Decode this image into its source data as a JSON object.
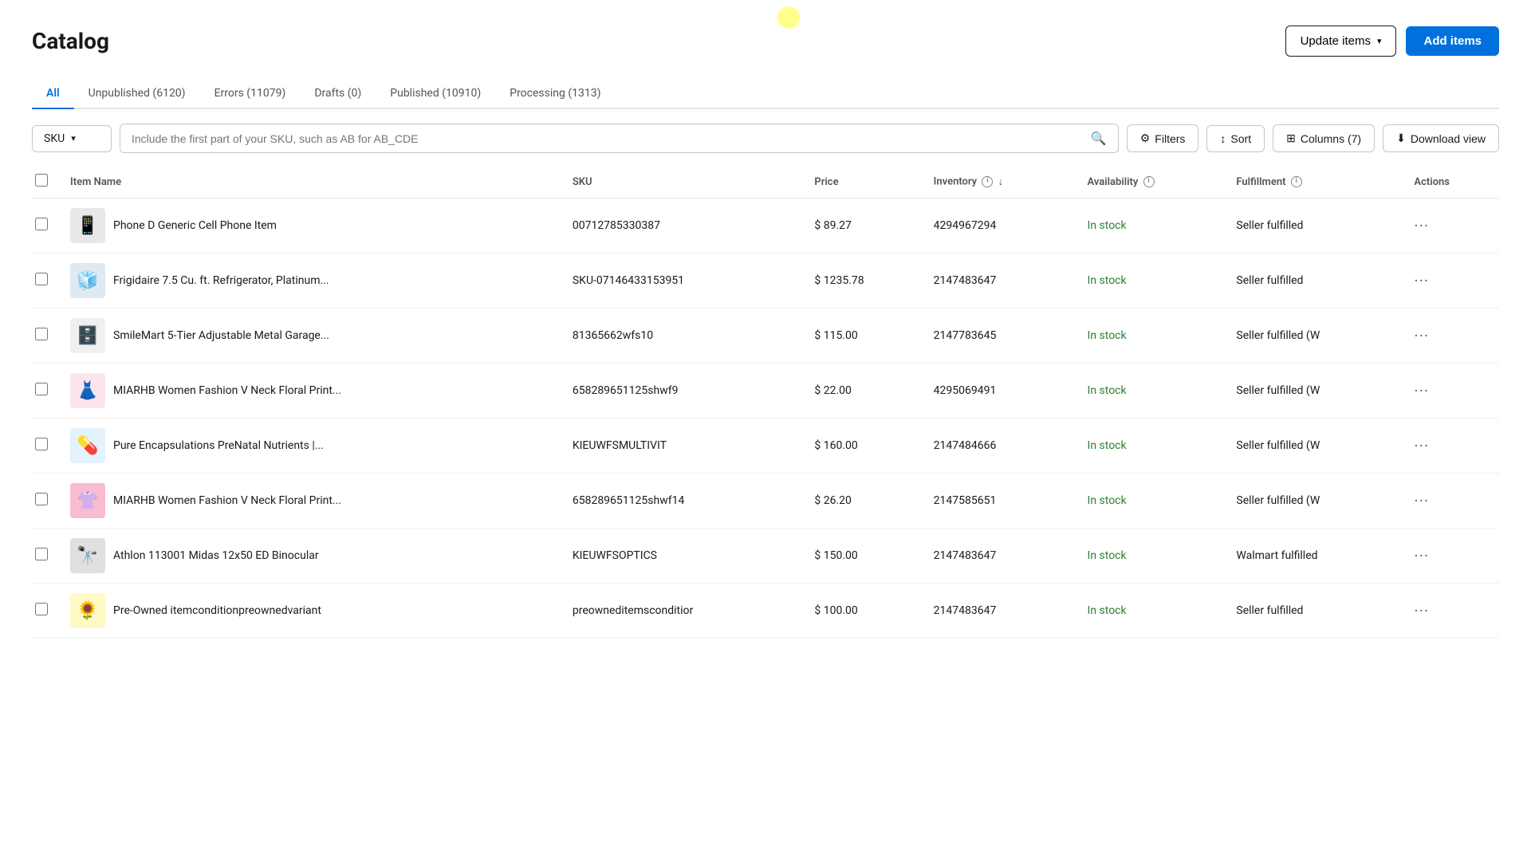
{
  "page": {
    "title": "Catalog"
  },
  "header": {
    "update_items_label": "Update items",
    "add_items_label": "Add items"
  },
  "tabs": [
    {
      "id": "all",
      "label": "All",
      "active": true
    },
    {
      "id": "unpublished",
      "label": "Unpublished (6120)",
      "active": false
    },
    {
      "id": "errors",
      "label": "Errors (11079)",
      "active": false
    },
    {
      "id": "drafts",
      "label": "Drafts (0)",
      "active": false
    },
    {
      "id": "published",
      "label": "Published (10910)",
      "active": false
    },
    {
      "id": "processing",
      "label": "Processing (1313)",
      "active": false
    }
  ],
  "toolbar": {
    "sku_label": "SKU",
    "search_placeholder": "Include the first part of your SKU, such as AB for AB_CDE",
    "filters_label": "Filters",
    "sort_label": "Sort",
    "columns_label": "Columns (7)",
    "download_label": "Download view"
  },
  "table": {
    "columns": [
      {
        "id": "name",
        "label": "Item Name"
      },
      {
        "id": "sku",
        "label": "SKU"
      },
      {
        "id": "price",
        "label": "Price"
      },
      {
        "id": "inventory",
        "label": "Inventory",
        "has_info": true,
        "has_sort": true
      },
      {
        "id": "availability",
        "label": "Availability",
        "has_info": true
      },
      {
        "id": "fulfillment",
        "label": "Fulfillment",
        "has_info": true
      },
      {
        "id": "actions",
        "label": "Actions"
      }
    ],
    "rows": [
      {
        "id": 1,
        "img_emoji": "📱",
        "img_bg": "#e8e8e8",
        "name": "Phone D Generic Cell Phone Item",
        "sku": "00712785330387",
        "price": "$ 89.27",
        "inventory": "4294967294",
        "availability": "In stock",
        "fulfillment": "Seller fulfilled"
      },
      {
        "id": 2,
        "img_emoji": "🧊",
        "img_bg": "#e0e8f0",
        "name": "Frigidaire 7.5 Cu. ft. Refrigerator, Platinum...",
        "sku": "SKU-07146433153951",
        "price": "$ 1235.78",
        "inventory": "2147483647",
        "availability": "In stock",
        "fulfillment": "Seller fulfilled"
      },
      {
        "id": 3,
        "img_emoji": "🗄️",
        "img_bg": "#f0f0f0",
        "name": "SmileMart 5-Tier Adjustable Metal Garage...",
        "sku": "81365662wfs10",
        "price": "$ 115.00",
        "inventory": "2147783645",
        "availability": "In stock",
        "fulfillment": "Seller fulfilled (W"
      },
      {
        "id": 4,
        "img_emoji": "👗",
        "img_bg": "#fce4ec",
        "name": "MIARHB Women Fashion V Neck Floral Print...",
        "sku": "658289651125shwf9",
        "price": "$ 22.00",
        "inventory": "4295069491",
        "availability": "In stock",
        "fulfillment": "Seller fulfilled (W"
      },
      {
        "id": 5,
        "img_emoji": "💊",
        "img_bg": "#e3f2fd",
        "name": "Pure Encapsulations PreNatal Nutrients |...",
        "sku": "KIEUWFSMULTIVIT",
        "price": "$ 160.00",
        "inventory": "2147484666",
        "availability": "In stock",
        "fulfillment": "Seller fulfilled (W"
      },
      {
        "id": 6,
        "img_emoji": "👚",
        "img_bg": "#f8bbd0",
        "name": "MIARHB Women Fashion V Neck Floral Print...",
        "sku": "658289651125shwf14",
        "price": "$ 26.20",
        "inventory": "2147585651",
        "availability": "In stock",
        "fulfillment": "Seller fulfilled (W"
      },
      {
        "id": 7,
        "img_emoji": "🔭",
        "img_bg": "#e0e0e0",
        "name": "Athlon 113001 Midas 12x50 ED Binocular",
        "sku": "KIEUWFSOPTICS",
        "price": "$ 150.00",
        "inventory": "2147483647",
        "availability": "In stock",
        "fulfillment": "Walmart fulfilled"
      },
      {
        "id": 8,
        "img_emoji": "🌻",
        "img_bg": "#fff9c4",
        "name": "Pre-Owned itemconditionpreownedvariant",
        "sku": "preowneditemsconditior",
        "price": "$ 100.00",
        "inventory": "2147483647",
        "availability": "In stock",
        "fulfillment": "Seller fulfilled"
      }
    ]
  }
}
